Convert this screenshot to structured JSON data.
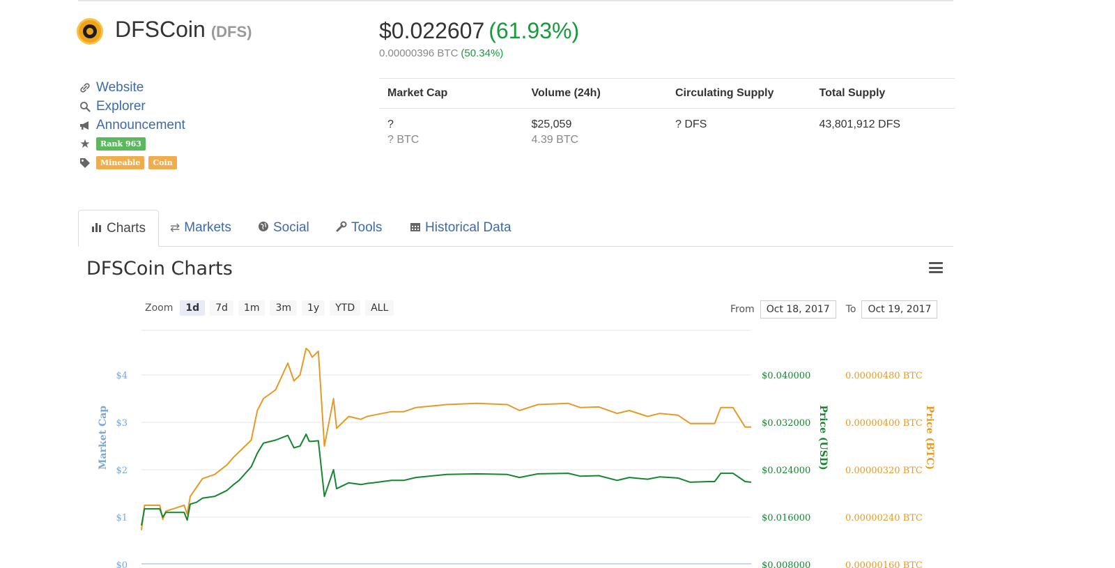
{
  "header": {
    "name": "DFSCoin",
    "symbol": "(DFS)",
    "price_usd": "$0.022607",
    "change_usd": "(61.93%)",
    "price_btc": "0.00000396 BTC",
    "change_btc": "(50.34%)"
  },
  "links": {
    "website": "Website",
    "explorer": "Explorer",
    "announcement": "Announcement",
    "rank": "Rank 963",
    "tags": [
      "Mineable",
      "Coin"
    ]
  },
  "stats": {
    "headers": [
      "Market Cap",
      "Volume (24h)",
      "Circulating Supply",
      "Total Supply"
    ],
    "market_cap": [
      "?",
      "? BTC"
    ],
    "volume": [
      "$25,059",
      "4.39 BTC"
    ],
    "circulating": [
      "? DFS"
    ],
    "total": [
      "43,801,912 DFS"
    ]
  },
  "tabs": [
    "Charts",
    "Markets",
    "Social",
    "Tools",
    "Historical Data"
  ],
  "charts": {
    "title": "DFSCoin Charts",
    "zoom_label": "Zoom",
    "zoom_options": [
      "1d",
      "7d",
      "1m",
      "3m",
      "1y",
      "YTD",
      "ALL"
    ],
    "from_label": "From",
    "from_value": "Oct 18, 2017",
    "to_label": "To",
    "to_value": "Oct 19, 2017"
  },
  "colors": {
    "usd": "#13862e",
    "btc": "#e59a26",
    "marketcap": "#7ba7d7",
    "positive": "#169b3c"
  },
  "chart_data": {
    "type": "line",
    "axes": {
      "left": {
        "label": "Market Cap",
        "ticks": [
          "$0",
          "$1",
          "$2",
          "$3",
          "$4"
        ]
      },
      "right_usd": {
        "label": "Price (USD)",
        "ticks": [
          "$0.008000",
          "$0.016000",
          "$0.024000",
          "$0.032000",
          "$0.040000"
        ]
      },
      "right_btc": {
        "label": "Price (BTC)",
        "ticks": [
          "0.00000160 BTC",
          "0.00000240 BTC",
          "0.00000320 BTC",
          "0.00000400 BTC",
          "0.00000480 BTC"
        ]
      }
    },
    "ylim_usd": [
      0.008,
      0.044
    ],
    "ylim_btc": [
      1.6e-06,
      5.2e-06
    ],
    "series": [
      {
        "name": "Price (USD)",
        "x": [
          0,
          0.005,
          0.03,
          0.035,
          0.04,
          0.07,
          0.075,
          0.08,
          0.09,
          0.1,
          0.12,
          0.14,
          0.15,
          0.16,
          0.18,
          0.19,
          0.2,
          0.22,
          0.24,
          0.25,
          0.26,
          0.27,
          0.275,
          0.28,
          0.29,
          0.3,
          0.315,
          0.32,
          0.34,
          0.36,
          0.37,
          0.38,
          0.395,
          0.41,
          0.43,
          0.45,
          0.5,
          0.55,
          0.6,
          0.62,
          0.65,
          0.7,
          0.72,
          0.75,
          0.78,
          0.8,
          0.83,
          0.85,
          0.88,
          0.9,
          0.93,
          0.94,
          0.95,
          0.97,
          0.99,
          1
        ],
        "values": [
          0.0146,
          0.0174,
          0.0174,
          0.016,
          0.0168,
          0.0168,
          0.0155,
          0.0182,
          0.0185,
          0.0192,
          0.0195,
          0.0205,
          0.0214,
          0.0222,
          0.0245,
          0.0268,
          0.0285,
          0.029,
          0.0298,
          0.0277,
          0.028,
          0.03,
          0.0288,
          0.0288,
          0.0289,
          0.0195,
          0.024,
          0.0208,
          0.0218,
          0.0215,
          0.0217,
          0.0218,
          0.022,
          0.0222,
          0.0222,
          0.0227,
          0.0232,
          0.0233,
          0.0232,
          0.0227,
          0.0233,
          0.0234,
          0.0229,
          0.023,
          0.0222,
          0.0227,
          0.0224,
          0.0228,
          0.0226,
          0.0219,
          0.022,
          0.022,
          0.0234,
          0.0234,
          0.022,
          0.0219
        ]
      },
      {
        "name": "Price (BTC)",
        "x": [
          0,
          0.005,
          0.03,
          0.035,
          0.04,
          0.07,
          0.075,
          0.08,
          0.09,
          0.1,
          0.12,
          0.14,
          0.15,
          0.16,
          0.18,
          0.19,
          0.2,
          0.22,
          0.24,
          0.25,
          0.26,
          0.27,
          0.275,
          0.28,
          0.29,
          0.3,
          0.315,
          0.32,
          0.34,
          0.36,
          0.37,
          0.38,
          0.395,
          0.41,
          0.43,
          0.45,
          0.5,
          0.55,
          0.6,
          0.62,
          0.65,
          0.7,
          0.72,
          0.75,
          0.78,
          0.8,
          0.83,
          0.85,
          0.88,
          0.9,
          0.93,
          0.94,
          0.95,
          0.97,
          0.99,
          1
        ],
        "values": [
          2.18e-06,
          2.6e-06,
          2.6e-06,
          2.36e-06,
          2.5e-06,
          2.6e-06,
          2.45e-06,
          2.75e-06,
          2.9e-06,
          3.05e-06,
          3.12e-06,
          3.28e-06,
          3.4e-06,
          3.5e-06,
          3.7e-06,
          4.2e-06,
          4.4e-06,
          4.55e-06,
          5e-06,
          4.7e-06,
          4.8e-06,
          5.25e-06,
          5.2e-06,
          5.1e-06,
          5.2e-06,
          3.6e-06,
          4.4e-06,
          3.9e-06,
          4.1e-06,
          4.05e-06,
          4.1e-06,
          4.12e-06,
          4.15e-06,
          4.18e-06,
          4.18e-06,
          4.25e-06,
          4.3e-06,
          4.32e-06,
          4.3e-06,
          4.2e-06,
          4.3e-06,
          4.32e-06,
          4.25e-06,
          4.26e-06,
          4.15e-06,
          4.2e-06,
          4.1e-06,
          4.15e-06,
          4.12e-06,
          3.98e-06,
          3.98e-06,
          3.98e-06,
          4.25e-06,
          4.25e-06,
          3.92e-06,
          3.92e-06
        ]
      }
    ]
  }
}
